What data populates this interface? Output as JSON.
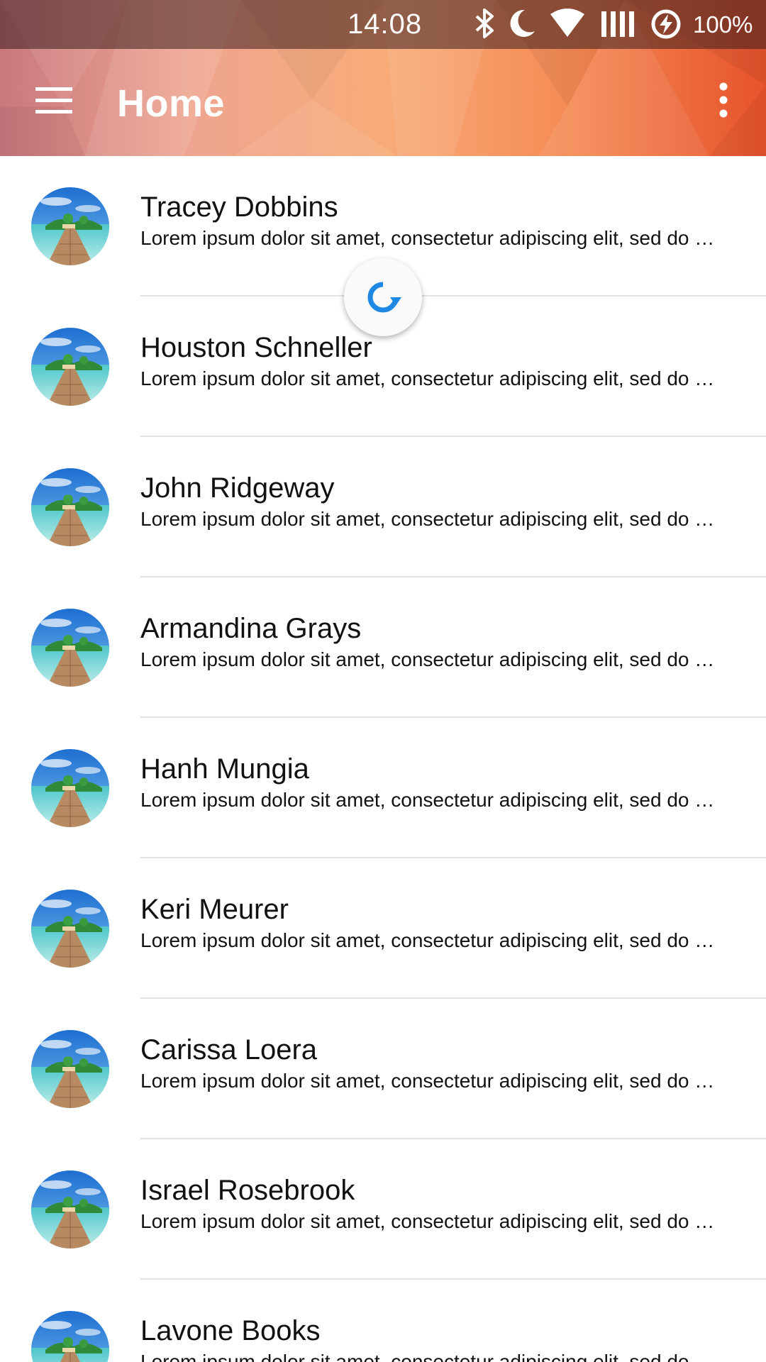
{
  "status_bar": {
    "time": "14:08",
    "battery_percent": "100%",
    "icons": [
      "bluetooth-icon",
      "do-not-disturb-moon-icon",
      "wifi-icon",
      "signal-icon",
      "battery-saver-icon"
    ]
  },
  "app_bar": {
    "title": "Home",
    "menu_icon": "hamburger-menu-icon",
    "overflow_icon": "more-vertical-icon",
    "colors": {
      "left": "#c9787e",
      "mid": "#f6a06a",
      "right": "#e85a2e"
    }
  },
  "refresh_indicator": {
    "icon": "refresh-icon",
    "color": "#1e88e5"
  },
  "contacts": [
    {
      "name": "Tracey Dobbins",
      "description": "Lorem ipsum dolor sit amet, consectetur adipiscing elit, sed do eiusmod tempor incididunt"
    },
    {
      "name": "Houston Schneller",
      "description": "Lorem ipsum dolor sit amet, consectetur adipiscing elit, sed do eiusmod tempor incididunt"
    },
    {
      "name": "John Ridgeway",
      "description": "Lorem ipsum dolor sit amet, consectetur adipiscing elit, sed do eiusmod tempor incididunt"
    },
    {
      "name": "Armandina Grays",
      "description": "Lorem ipsum dolor sit amet, consectetur adipiscing elit, sed do eiusmod tempor incididunt"
    },
    {
      "name": "Hanh Mungia",
      "description": "Lorem ipsum dolor sit amet, consectetur adipiscing elit, sed do eiusmod tempor incididunt"
    },
    {
      "name": "Keri Meurer",
      "description": "Lorem ipsum dolor sit amet, consectetur adipiscing elit, sed do eiusmod tempor incididunt"
    },
    {
      "name": "Carissa Loera",
      "description": "Lorem ipsum dolor sit amet, consectetur adipiscing elit, sed do eiusmod tempor incididunt"
    },
    {
      "name": "Israel Rosebrook",
      "description": "Lorem ipsum dolor sit amet, consectetur adipiscing elit, sed do eiusmod tempor incididunt"
    },
    {
      "name": "Lavone Books",
      "description": "Lorem ipsum dolor sit amet, consectetur adipiscing elit, sed do eiusmod tempor incididunt"
    }
  ]
}
